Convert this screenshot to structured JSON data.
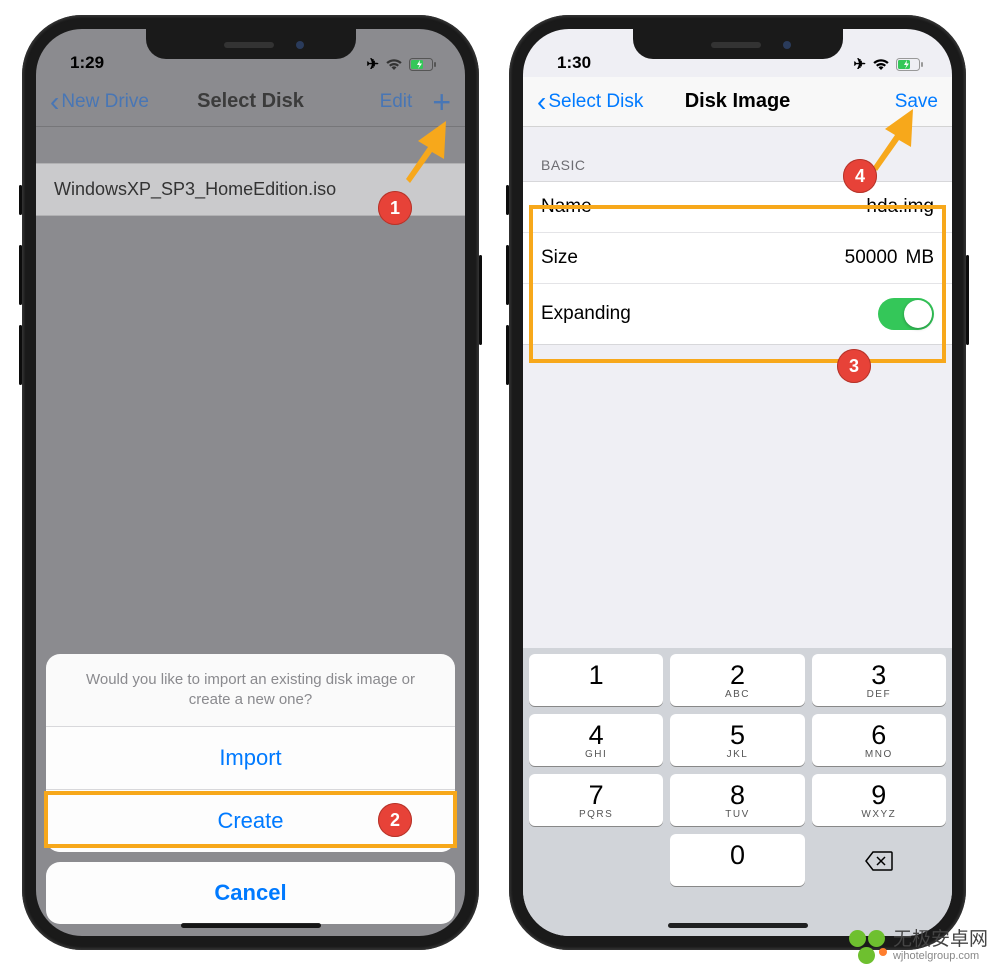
{
  "phone1": {
    "time": "1:29",
    "nav_back": "New Drive",
    "nav_title": "Select Disk",
    "nav_edit": "Edit",
    "list_item": "WindowsXP_SP3_HomeEdition.iso",
    "sheet_msg": "Would you like to import an existing disk image or create a new one?",
    "sheet_import": "Import",
    "sheet_create": "Create",
    "sheet_cancel": "Cancel"
  },
  "phone2": {
    "time": "1:30",
    "nav_back": "Select Disk",
    "nav_title": "Disk Image",
    "nav_save": "Save",
    "section": "BASIC",
    "name_label": "Name",
    "name_value": "hda.img",
    "size_label": "Size",
    "size_value": "50000",
    "size_unit": "MB",
    "expanding_label": "Expanding"
  },
  "keypad": {
    "k1": {
      "n": "1",
      "l": ""
    },
    "k2": {
      "n": "2",
      "l": "ABC"
    },
    "k3": {
      "n": "3",
      "l": "DEF"
    },
    "k4": {
      "n": "4",
      "l": "GHI"
    },
    "k5": {
      "n": "5",
      "l": "JKL"
    },
    "k6": {
      "n": "6",
      "l": "MNO"
    },
    "k7": {
      "n": "7",
      "l": "PQRS"
    },
    "k8": {
      "n": "8",
      "l": "TUV"
    },
    "k9": {
      "n": "9",
      "l": "WXYZ"
    },
    "k0": {
      "n": "0",
      "l": ""
    }
  },
  "steps": {
    "s1": "1",
    "s2": "2",
    "s3": "3",
    "s4": "4"
  },
  "watermark": {
    "cn": "无极安卓网",
    "en": "wjhotelgroup.com"
  }
}
